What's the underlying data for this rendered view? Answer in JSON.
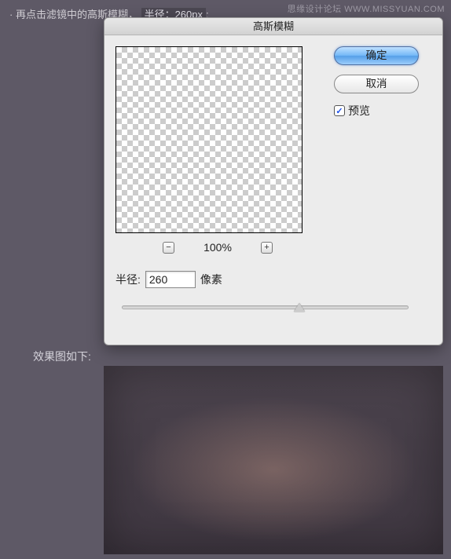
{
  "watermark": "思缘设计论坛  WWW.MISSYUAN.COM",
  "instruction": {
    "prefix": "· 再点击滤镜中的高斯模糊，",
    "highlight": "半径：260px"
  },
  "dialog": {
    "title": "高斯模糊",
    "zoom": {
      "minus": "−",
      "plus": "+",
      "percent": "100%"
    },
    "radius": {
      "label": "半径:",
      "value": "260",
      "unit": "像素"
    },
    "slider": {
      "position_pct": 60
    },
    "buttons": {
      "ok": "确定",
      "cancel": "取消"
    },
    "preview": {
      "checked": "✓",
      "label": "预览"
    }
  },
  "result_label": "效果图如下:"
}
